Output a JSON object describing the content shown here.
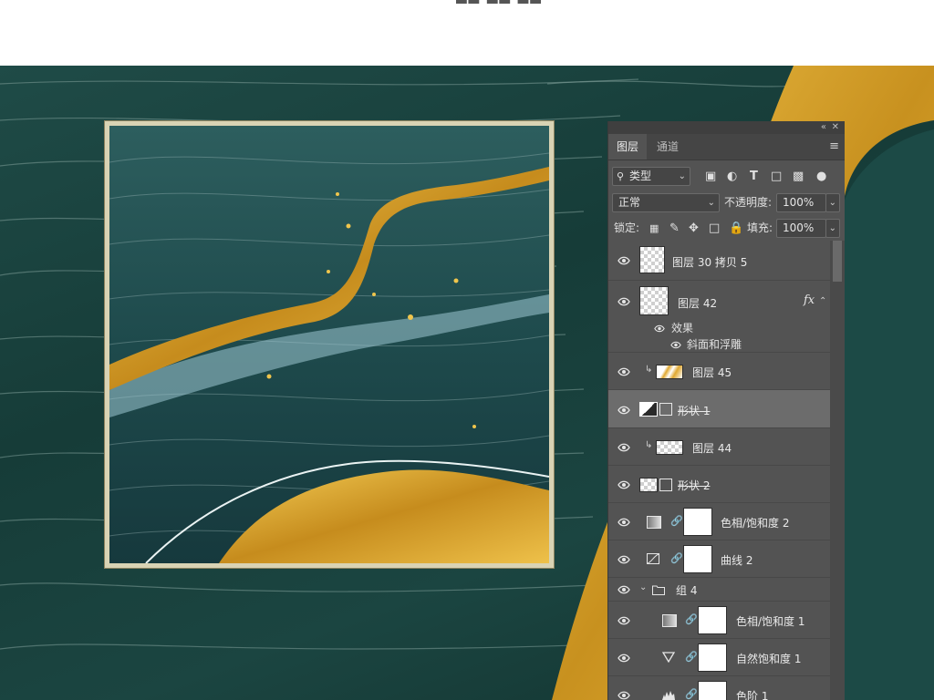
{
  "panel": {
    "tabs": [
      {
        "label": "图层",
        "active": true
      },
      {
        "label": "通道",
        "active": false
      }
    ],
    "filter": {
      "label": "类型",
      "search_icon": "search-icon"
    },
    "filter_icons": [
      "image-filter-icon",
      "adjustment-filter-icon",
      "type-filter-icon",
      "shape-filter-icon",
      "smart-object-filter-icon",
      "toggle-filter-icon"
    ],
    "blend_mode": "正常",
    "opacity_label": "不透明度:",
    "opacity_value": "100%",
    "lock_label": "锁定:",
    "lock_icons": [
      "lock-transparent-icon",
      "lock-paint-icon",
      "lock-move-icon",
      "lock-artboard-icon",
      "lock-all-icon"
    ],
    "fill_label": "填充:",
    "fill_value": "100%"
  },
  "layers": [
    {
      "name": "图层 30 拷贝 5"
    },
    {
      "name": "图层 42",
      "fx": "fx",
      "effects_label": "效果",
      "effect_item": "斜面和浮雕"
    },
    {
      "name": "图层 45"
    },
    {
      "name": "形状 1",
      "selected": true
    },
    {
      "name": "图层 44"
    },
    {
      "name": "形状 2"
    },
    {
      "name": "色相/饱和度 2"
    },
    {
      "name": "曲线 2"
    },
    {
      "name": "组 4"
    },
    {
      "name": "色相/饱和度 1"
    },
    {
      "name": "自然饱和度 1"
    },
    {
      "name": "色阶 1"
    }
  ],
  "colors": {
    "panel_bg": "#535353",
    "selected_row": "#6c6c6c",
    "artwork_teal": "#1f4b47",
    "gold": "#d9a52b",
    "frame": "#d9d3b4"
  }
}
